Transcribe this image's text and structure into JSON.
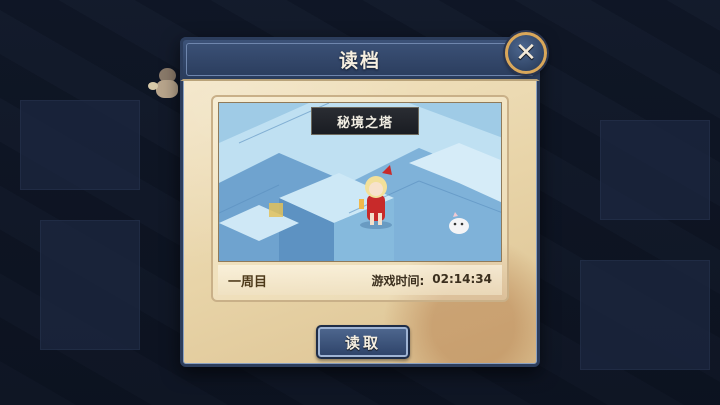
{
  "dialog": {
    "title": "读档",
    "close_icon": "close-x-icon"
  },
  "save_slot": {
    "map_name": "秘境之塔",
    "playthrough": "一周目",
    "play_time_label": "游戏时间:",
    "play_time_value": "02:14:34",
    "thumbnail": "save-thumbnail-ice-tower"
  },
  "actions": {
    "load_label": "读取"
  },
  "colors": {
    "dialog_header": "#2a3c5c",
    "parchment": "#e8d4a8",
    "close_ring": "#d9a75a",
    "ice_blue": "#8cc0e0"
  }
}
